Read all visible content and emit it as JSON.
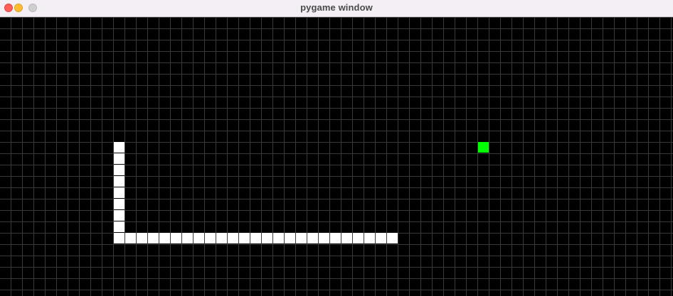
{
  "window": {
    "title": "pygame window",
    "controls": [
      "close",
      "minimize",
      "zoom"
    ]
  },
  "game": {
    "grid_color": "#3a3a3a",
    "background_color": "#000000",
    "snake_color": "#ffffff",
    "food_color": "#00ff00",
    "snake": [
      [
        10,
        11
      ],
      [
        10,
        12
      ],
      [
        10,
        13
      ],
      [
        10,
        14
      ],
      [
        10,
        15
      ],
      [
        10,
        16
      ],
      [
        10,
        17
      ],
      [
        10,
        18
      ],
      [
        10,
        19
      ],
      [
        11,
        19
      ],
      [
        12,
        19
      ],
      [
        13,
        19
      ],
      [
        14,
        19
      ],
      [
        15,
        19
      ],
      [
        16,
        19
      ],
      [
        17,
        19
      ],
      [
        18,
        19
      ],
      [
        19,
        19
      ],
      [
        20,
        19
      ],
      [
        21,
        19
      ],
      [
        22,
        19
      ],
      [
        23,
        19
      ],
      [
        24,
        19
      ],
      [
        25,
        19
      ],
      [
        26,
        19
      ],
      [
        27,
        19
      ],
      [
        28,
        19
      ],
      [
        29,
        19
      ],
      [
        30,
        19
      ],
      [
        31,
        19
      ],
      [
        32,
        19
      ],
      [
        33,
        19
      ],
      [
        34,
        19
      ]
    ],
    "food": [
      42,
      11
    ]
  }
}
